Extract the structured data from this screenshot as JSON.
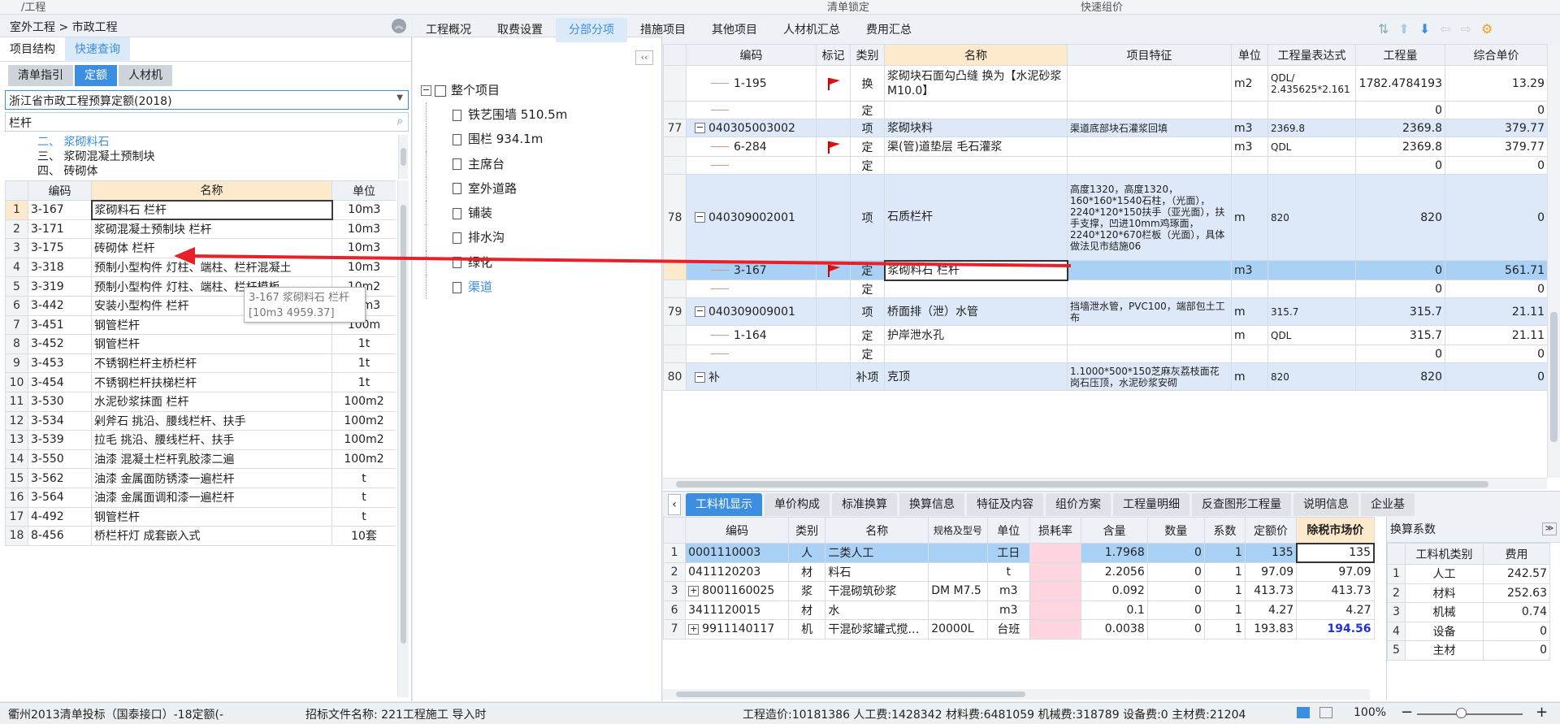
{
  "topbar": {
    "left": "/工程",
    "center1": "清单锁定",
    "center2": "快速组价"
  },
  "left": {
    "breadcrumb": "室外工程 > 市政工程",
    "tabs": [
      "项目结构",
      "快速查询"
    ],
    "subtabs": [
      "清单指引",
      "定额",
      "人材机"
    ],
    "quota_select": "浙江省市政工程预算定额(2018)",
    "search_value": "栏杆",
    "tree": [
      "二、 浆砌料石",
      "三、 浆砌混凝土预制块",
      "四、 砖砌体"
    ],
    "columns": [
      "编码",
      "名称",
      "单位"
    ],
    "rows": [
      [
        "1",
        "3-167",
        "浆砌料石 栏杆",
        "10m3"
      ],
      [
        "2",
        "3-171",
        "浆砌混凝土预制块 栏杆",
        "10m3"
      ],
      [
        "3",
        "3-175",
        "砖砌体 栏杆",
        "10m3"
      ],
      [
        "4",
        "3-318",
        "预制小型构件 灯柱、端柱、栏杆混凝土",
        "10m3"
      ],
      [
        "5",
        "3-319",
        "预制小型构件 灯柱、端柱、栏杆模板",
        "10m2"
      ],
      [
        "6",
        "3-442",
        "安装小型构件 栏杆",
        "10m3"
      ],
      [
        "7",
        "3-451",
        "钢管栏杆",
        "100m"
      ],
      [
        "8",
        "3-452",
        "钢管栏杆",
        "1t"
      ],
      [
        "9",
        "3-453",
        "不锈钢栏杆主桥栏杆",
        "1t"
      ],
      [
        "10",
        "3-454",
        "不锈钢栏杆扶梯栏杆",
        "1t"
      ],
      [
        "11",
        "3-530",
        "水泥砂浆抹面 栏杆",
        "100m2"
      ],
      [
        "12",
        "3-534",
        "剁斧石 挑沿、腰线栏杆、扶手",
        "100m2"
      ],
      [
        "13",
        "3-539",
        "拉毛 挑沿、腰线栏杆、扶手",
        "100m2"
      ],
      [
        "14",
        "3-550",
        "油漆 混凝土栏杆乳胶漆二遍",
        "100m2"
      ],
      [
        "15",
        "3-562",
        "油漆 金属面防锈漆一遍栏杆",
        "t"
      ],
      [
        "16",
        "3-564",
        "油漆 金属面调和漆一遍栏杆",
        "t"
      ],
      [
        "17",
        "4-492",
        "钢管栏杆",
        "t"
      ],
      [
        "18",
        "8-456",
        "桥栏杆灯 成套嵌入式",
        "10套"
      ]
    ],
    "tooltip": [
      "3-167 浆砌料石 栏杆",
      "[10m3 4959.37]"
    ]
  },
  "project_tree": {
    "root": "整个项目",
    "items": [
      "铁艺围墙 510.5m",
      "围栏 934.1m",
      "主席台",
      "室外道路",
      "铺装",
      "排水沟",
      "绿化",
      "渠道"
    ]
  },
  "right": {
    "tabs": [
      "工程概况",
      "取费设置",
      "分部分项",
      "措施项目",
      "其他项目",
      "人材机汇总",
      "费用汇总"
    ],
    "columns": [
      "编码",
      "标记",
      "类别",
      "名称",
      "项目特征",
      "单位",
      "工程量表达式",
      "工程量",
      "综合单价"
    ],
    "rows": [
      {
        "n": "",
        "code": "1-195",
        "flag": true,
        "cat": "换",
        "name": "浆砌块石面勾凸缝  换为【水泥砂浆 M10.0】",
        "feat": "",
        "unit": "m2",
        "expr": "QDL/ 2.435625*2.161",
        "qty": "1782.4784193",
        "price": "13.29"
      },
      {
        "n": "",
        "code": "",
        "flag": false,
        "cat": "定",
        "name": "",
        "feat": "",
        "unit": "",
        "expr": "",
        "qty": "0",
        "price": "0"
      },
      {
        "n": "77",
        "code": "040305003002",
        "flag": false,
        "cat": "项",
        "name": "浆砌块料",
        "feat": "渠道底部块石灌浆回填",
        "unit": "m3",
        "expr": "2369.8",
        "qty": "2369.8",
        "price": "379.77"
      },
      {
        "n": "",
        "code": "6-284",
        "flag": true,
        "cat": "定",
        "name": "渠(管)道垫层 毛石灌浆",
        "feat": "",
        "unit": "m3",
        "expr": "QDL",
        "qty": "2369.8",
        "price": "379.77"
      },
      {
        "n": "",
        "code": "",
        "flag": false,
        "cat": "定",
        "name": "",
        "feat": "",
        "unit": "",
        "expr": "",
        "qty": "0",
        "price": "0"
      },
      {
        "n": "78",
        "code": "040309002001",
        "flag": false,
        "cat": "项",
        "name": "石质栏杆",
        "feat": "高度1320，高度1320，160*160*1540石柱，（光面），2240*120*150扶手（亚光面），扶手支撑，凹进10mm鸡琢面，2240*120*670栏板（光面），具体做法见市结施06",
        "unit": "m",
        "expr": "820",
        "qty": "820",
        "price": "0"
      },
      {
        "n": "",
        "code": "3-167",
        "flag": true,
        "cat": "定",
        "name": "浆砌料石 栏杆",
        "feat": "",
        "unit": "m3",
        "expr": "",
        "qty": "0",
        "price": "561.71"
      },
      {
        "n": "",
        "code": "",
        "flag": false,
        "cat": "定",
        "name": "",
        "feat": "",
        "unit": "",
        "expr": "",
        "qty": "0",
        "price": "0"
      },
      {
        "n": "79",
        "code": "040309009001",
        "flag": false,
        "cat": "项",
        "name": "桥面排（泄）水管",
        "feat": "挡墙泄水管，PVC100，端部包土工布",
        "unit": "m",
        "expr": "315.7",
        "qty": "315.7",
        "price": "21.11"
      },
      {
        "n": "",
        "code": "1-164",
        "flag": false,
        "cat": "定",
        "name": "护岸泄水孔",
        "feat": "",
        "unit": "m",
        "expr": "QDL",
        "qty": "315.7",
        "price": "21.11"
      },
      {
        "n": "",
        "code": "",
        "flag": false,
        "cat": "定",
        "name": "",
        "feat": "",
        "unit": "",
        "expr": "",
        "qty": "0",
        "price": "0"
      },
      {
        "n": "80",
        "code": "补",
        "flag": false,
        "cat": "补项",
        "name": "克顶",
        "feat": "1.1000*500*150芝麻灰荔枝面花岗石压顶，水泥砂浆安砌",
        "unit": "m",
        "expr": "820",
        "qty": "820",
        "price": "0"
      }
    ],
    "bottom_tabs": [
      "工料机显示",
      "单价构成",
      "标准换算",
      "换算信息",
      "特征及内容",
      "组价方案",
      "工程量明细",
      "反查图形工程量",
      "说明信息",
      "企业基"
    ],
    "bottom_columns": [
      "编码",
      "类别",
      "名称",
      "规格及型号",
      "单位",
      "损耗率",
      "含量",
      "数量",
      "系数",
      "定额价",
      "除税市场价"
    ],
    "bottom_rows": [
      [
        "1",
        "0001110003",
        "人",
        "二类人工",
        "",
        "工日",
        "",
        "1.7968",
        "0",
        "1",
        "135",
        "135"
      ],
      [
        "2",
        "0411120203",
        "材",
        "料石",
        "",
        "t",
        "",
        "2.2056",
        "0",
        "1",
        "97.09",
        "97.09"
      ],
      [
        "3",
        "8001160025",
        "浆",
        "干混砌筑砂浆",
        "DM M7.5",
        "m3",
        "",
        "0.092",
        "0",
        "1",
        "413.73",
        "413.73"
      ],
      [
        "6",
        "3411120015",
        "材",
        "水",
        "",
        "m3",
        "",
        "0.1",
        "0",
        "1",
        "4.27",
        "4.27"
      ],
      [
        "7",
        "9911140117",
        "机",
        "干混砂浆罐式搅…",
        "20000L",
        "台班",
        "",
        "0.0038",
        "0",
        "1",
        "193.83",
        "194.56"
      ]
    ],
    "conv": {
      "title": "换算系数",
      "columns": [
        "工料机类别",
        "费用"
      ],
      "rows": [
        [
          "1",
          "人工",
          "242.57"
        ],
        [
          "2",
          "材料",
          "252.63"
        ],
        [
          "3",
          "机械",
          "0.74"
        ],
        [
          "4",
          "设备",
          "0"
        ],
        [
          "5",
          "主材",
          "0"
        ]
      ]
    }
  },
  "status": {
    "left": "衢州2013清单投标（国泰接口）-18定额(-",
    "file": "招标文件名称: 221工程施工 导入时",
    "cost": "工程造价:10181386  人工费:1428342  材料费:6481059  机械费:318789  设备费:0  主材费:21204",
    "zoom": "100%"
  },
  "colors": {
    "accent": "#3b8ee0",
    "selected_row": "#a9d1f5",
    "item_row": "#dde9f8",
    "header_orange": "#fde9cc",
    "arrow": "#e8202a",
    "content_pink": "#ffd6e0"
  }
}
